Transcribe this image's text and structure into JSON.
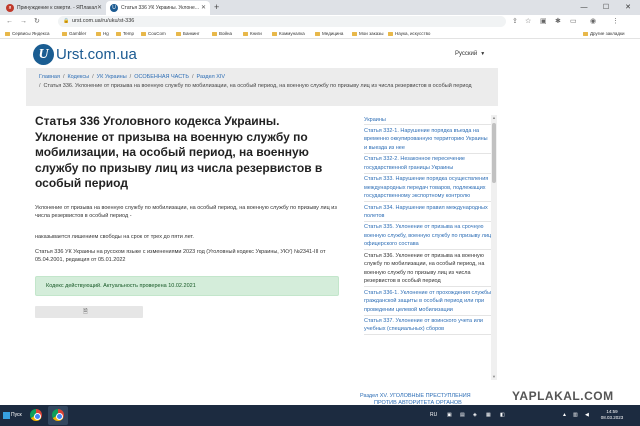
{
  "browser": {
    "tabs": [
      {
        "label": "Принуждение к смерти. - ЯПлакал"
      },
      {
        "label": "Статья 336 УК Украины. Уклоне..."
      }
    ],
    "new_tab": "+",
    "url": "urst.com.ua/ru/uku/st-336",
    "bookmarks": [
      "Сервисы Яндекса",
      "Gambler",
      "Hg",
      "Temp",
      "CouCom",
      "Банкинг",
      "Война",
      "Книги",
      "Коммуналка",
      "Медицина",
      "Мои заказы",
      "Наука, искусство"
    ],
    "other_bookmarks": "Другие закладки"
  },
  "site": {
    "logo_letter": "U",
    "logo_text": "Urst.com.ua",
    "language": "Русский"
  },
  "breadcrumb": {
    "items": [
      "Главная",
      "Кодексы",
      "УК Украины",
      "ОСОБЕННАЯ ЧАСТЬ",
      "Раздел XIV"
    ],
    "separator": "/",
    "current": "Статья 336. Уклонение от призыва на военную службу по мобилизации, на особый период, на военную службу по призыву лиц из числа резервистов в особый период"
  },
  "main": {
    "title": "Статья 336 Уголовного кодекса Украины. Уклонение от призыва на военную службу по мобилизации, на особый период, на военную службу по призыву лиц из числа резервистов в особый период",
    "text1": "Уклонение от призыва на военную службу по мобилизации, на особый период, на военную службу по призыву лиц из числа резервистов в особый период -",
    "text2": "наказывается лишением свободы на срок от трех до пяти лет.",
    "text3": "Статья 336 УК Украины на русском языке с изменениями 2023 год (Уголовный кодекс Украины, УКУ) №2341-III от 05.04.2001, редакция от 05.01.2022",
    "alert": "Кодекс действующий. Актуальность проверена 10.02.2021"
  },
  "sidebar": {
    "items": [
      {
        "text": "Украины",
        "current": false
      },
      {
        "text": "Статья 332-1. Нарушение порядка въезда на временно оккупированную территорию Украины и выезда из нее",
        "current": false
      },
      {
        "text": "Статья 332-2. Незаконное пересечение государственной границы Украины",
        "current": false
      },
      {
        "text": "Статья 333. Нарушение порядка осуществления международных передач товаров, подлежащих государственному экспортному контролю",
        "current": false
      },
      {
        "text": "Статья 334. Нарушение правил международных полетов",
        "current": false
      },
      {
        "text": "Статья 335. Уклонение от призыва на срочную военную службу, военную службу по призыву лиц офицерского состава",
        "current": false
      },
      {
        "text": "Статья 336. Уклонение от призыва на военную службу по мобилизации, на особый период, на военную службу по призыву лиц из числа резервистов в особый период",
        "current": true
      },
      {
        "text": "Статья 336-1. Уклонение от прохождения службы гражданской защиты в особый период или при проведении целевой мобилизации",
        "current": false
      },
      {
        "text": "Статья 337. Уклонение от воинского учета или учебных (специальных) сборов",
        "current": false
      }
    ],
    "section": "Раздел XV. УГОЛОВНЫЕ ПРЕСТУПЛЕНИЯ",
    "section_sub": "ПРОТИВ АВТОРИТЕТА ОРГАНОВ"
  },
  "watermark": "YAPLAKAL.COM",
  "taskbar": {
    "start": "Пуск",
    "lang": "RU",
    "time": "14:59",
    "date": "08.03.2023"
  },
  "colors": {
    "link": "#2c6db5",
    "brand": "#1b5a91",
    "alert_bg": "#d4edda",
    "alert_text": "#155724",
    "taskbar": "#1c2b40"
  }
}
